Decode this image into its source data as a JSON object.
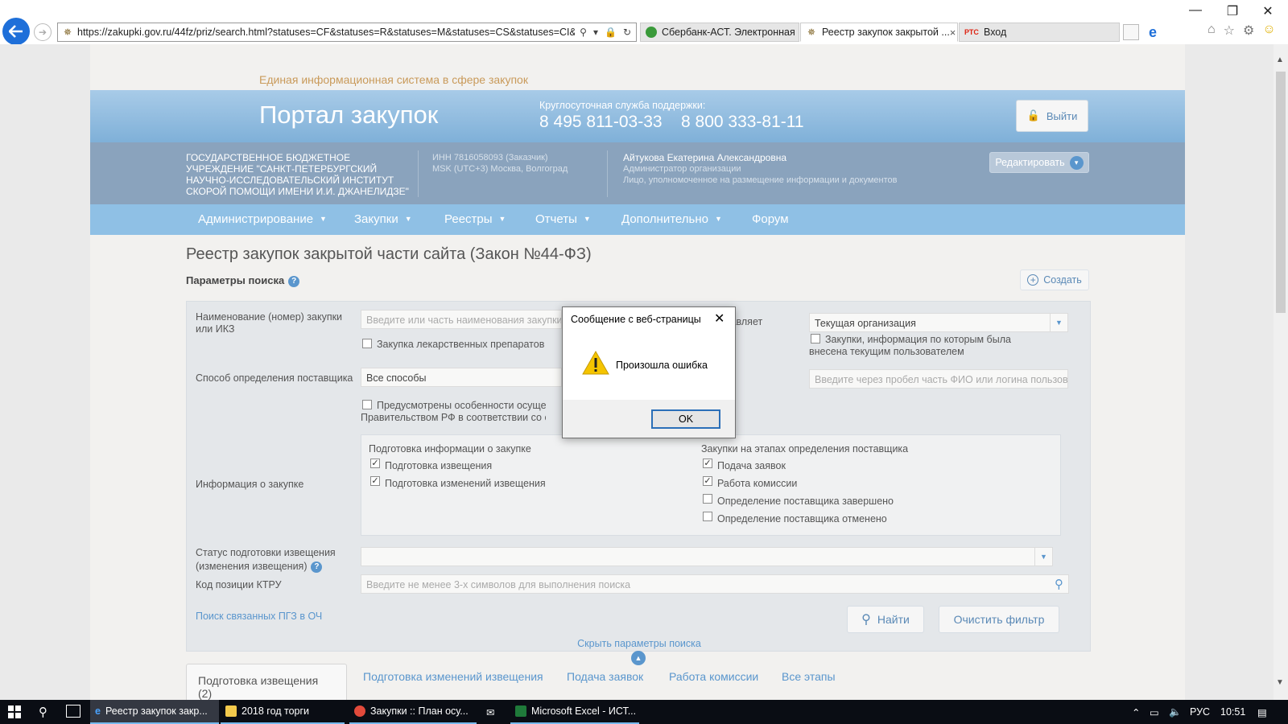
{
  "browser": {
    "url": "https://zakupki.gov.ru/44fz/priz/search.html?statuses=CF&statuses=R&statuses=M&statuses=CS&statuses=CI&statu",
    "tabs": [
      {
        "label": "Сбербанк-АСТ. Электронная ..."
      },
      {
        "label": "Реестр закупок закрытой ..."
      },
      {
        "label": "Вход"
      }
    ],
    "close_tab": "×",
    "rts_badge": "РТС"
  },
  "site": {
    "eis_title": "Единая информационная система в сфере закупок",
    "portal_title": "Портал закупок",
    "support_label": "Круглосуточная служба поддержки:",
    "phone1": "8 495 811-03-33",
    "phone2": "8 800 333-81-11",
    "logout": "Выйти",
    "org_name": "ГОСУДАРСТВЕННОЕ БЮДЖЕТНОЕ УЧРЕЖДЕНИЕ \"САНКТ-ПЕТЕРБУРГСКИЙ НАУЧНО-ИССЛЕДОВАТЕЛЬСКИЙ ИНСТИТУТ СКОРОЙ ПОМОЩИ ИМЕНИ И.И. ДЖАНЕЛИДЗЕ\"",
    "inn": "ИНН 7816058093 (Заказчик)",
    "timezone": "MSK (UTC+3) Москва, Волгоград",
    "user_name": "Айтукова Екатерина Александровна",
    "user_role": "Администратор организации",
    "user_role2": "Лицо, уполномоченное на размещение информации и документов",
    "edit": "Редактировать",
    "nav": [
      "Администрирование",
      "Закупки",
      "Реестры",
      "Отчеты",
      "Дополнительно",
      "Форум"
    ],
    "page_title": "Реестр закупок закрытой части сайта (Закон №44-ФЗ)",
    "params_label": "Параметры поиска",
    "help": "?",
    "create": "Создать"
  },
  "filter": {
    "name_label": "Наименование (номер) закупки или ИКЗ",
    "name_placeholder": "Введите или часть наименования закупки",
    "drugs_label": "Закупка лекарственных препаратов",
    "executes_label": "тавляет",
    "org_select": "Текущая организация",
    "user_changes_label": "Закупки, информация по которым была внесена текущим пользователем",
    "method_label": "Способ определения поставщика",
    "method_value": "Все способы",
    "fio_placeholder": "Введите через пробел часть ФИО или логина пользователя",
    "features_label": "Предусмотрены особенности осуществления",
    "features_label2": "Правительством РФ в соответствии со статьей",
    "info_label": "Информация о закупке",
    "prep_group": "Подготовка информации о закупке",
    "prep_items": [
      "Подготовка извещения",
      "Подготовка изменений извещения"
    ],
    "stage_group": "Закупки на этапах определения поставщика",
    "stage_items": [
      "Подача заявок",
      "Работа комиссии",
      "Определение поставщика завершено",
      "Определение поставщика отменено"
    ],
    "status_label": "Статус подготовки извещения (изменения извещения)",
    "ktru_label": "Код позиции КТРУ",
    "ktru_placeholder": "Введите не менее 3-х символов для выполнения поиска",
    "related_link": "Поиск связанных ПГЗ в ОЧ",
    "find": "Найти",
    "clear": "Очистить фильтр",
    "hide": "Скрыть параметры поиска"
  },
  "result_tabs": [
    "Подготовка извещения (2)",
    "Подготовка изменений извещения",
    "Подача заявок",
    "Работа комиссии",
    "Все этапы"
  ],
  "dialog": {
    "title": "Сообщение с веб-страницы",
    "message": "Произошла ошибка",
    "ok": "OK"
  },
  "taskbar": {
    "items": [
      "Реестр закупок закр...",
      "2018 год торги",
      "Закупки :: План осу...",
      "Microsoft Excel - ИСТ..."
    ],
    "lang": "РУС",
    "time": "10:51"
  }
}
